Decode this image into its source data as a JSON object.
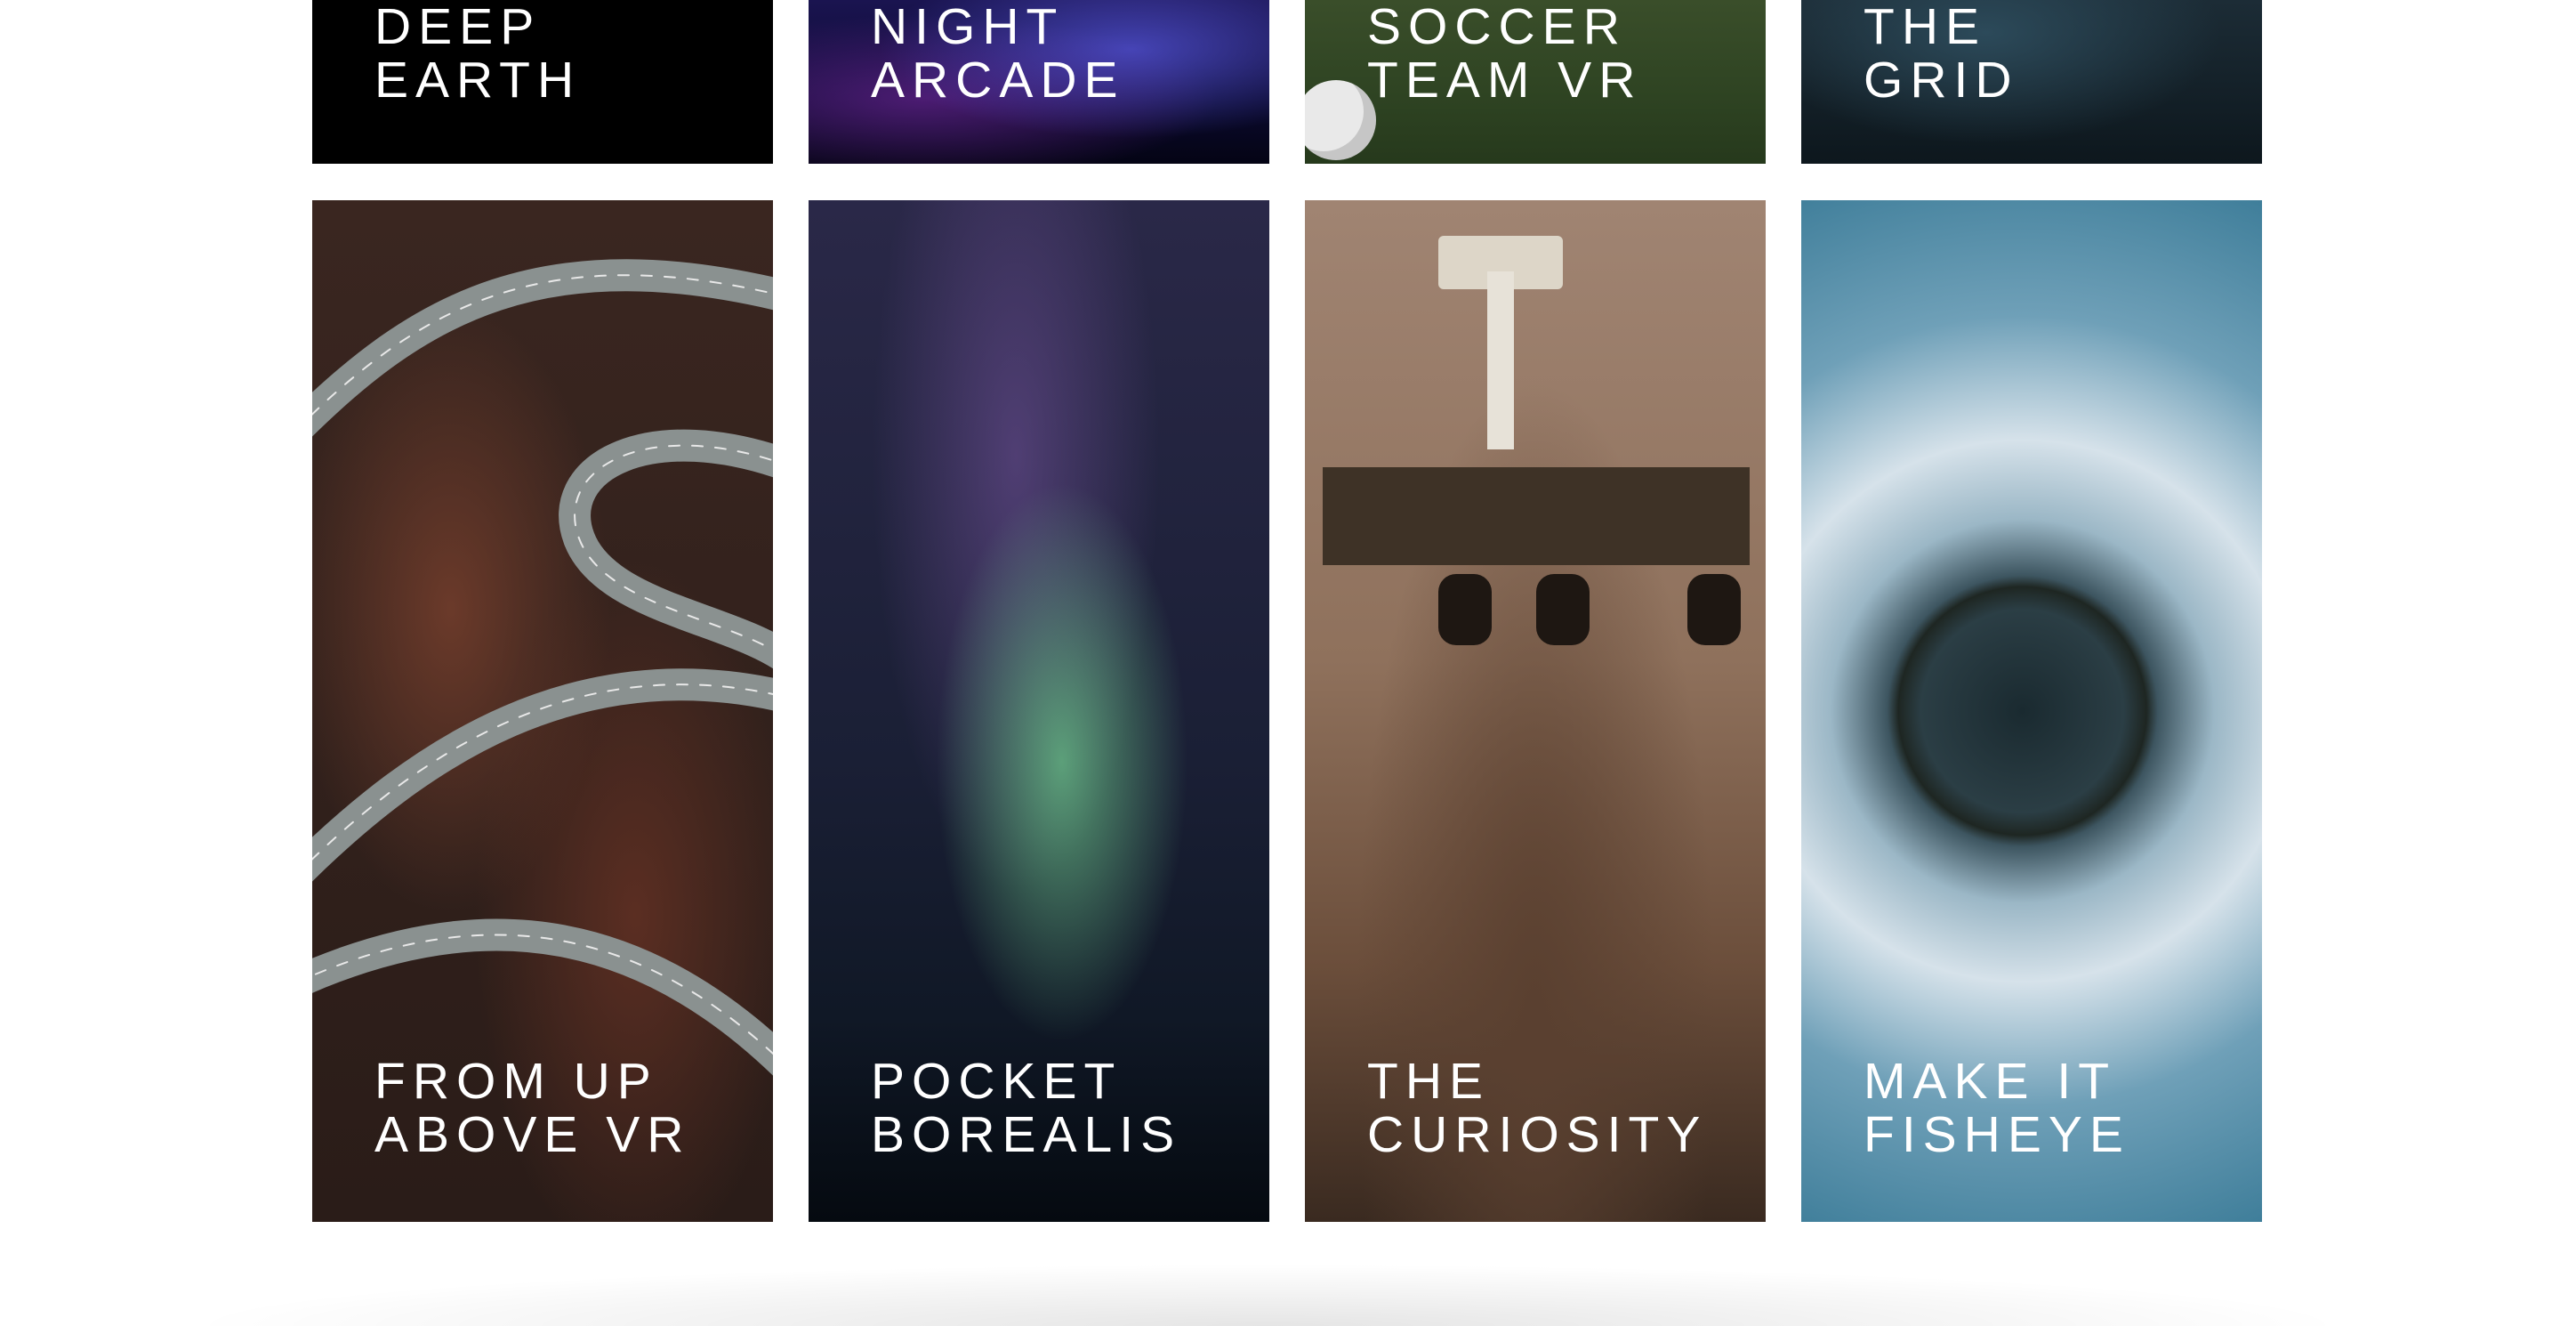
{
  "cards_row_1": [
    {
      "line1": "DEEP",
      "line2": "EARTH"
    },
    {
      "line1": "NIGHT",
      "line2": "ARCADE"
    },
    {
      "line1": "SOCCER",
      "line2": "TEAM VR"
    },
    {
      "line1": "THE",
      "line2": "GRID"
    }
  ],
  "cards_row_2": [
    {
      "line1": "FROM UP",
      "line2": "ABOVE VR"
    },
    {
      "line1": "POCKET",
      "line2": "BOREALIS"
    },
    {
      "line1": "THE",
      "line2": "CURIOSITY"
    },
    {
      "line1": "MAKE IT",
      "line2": "FISHEYE"
    }
  ],
  "colors": {
    "page_bg": "#ffffff",
    "title_text": "#ffffff"
  }
}
